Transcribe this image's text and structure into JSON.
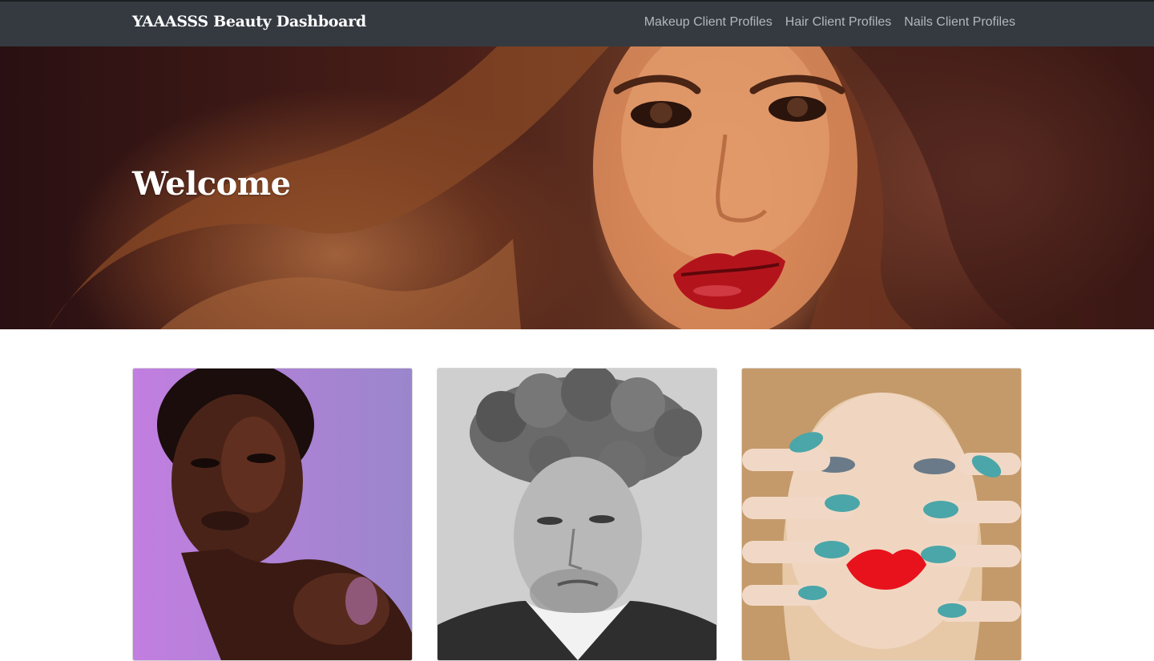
{
  "navbar": {
    "brand": "YAAASSS Beauty Dashboard",
    "links": [
      {
        "label": "Makeup Client Profiles"
      },
      {
        "label": "Hair Client Profiles"
      },
      {
        "label": "Nails Client Profiles"
      }
    ]
  },
  "hero": {
    "title": "Welcome",
    "image": "woman-red-lips-portrait"
  },
  "cards": [
    {
      "image": "makeup-portrait-purple-background"
    },
    {
      "image": "hair-portrait-curly-man-bw"
    },
    {
      "image": "nails-portrait-teal-nails"
    }
  ],
  "colors": {
    "navbar_bg": "#343a40",
    "nav_link": "#b3b8bd",
    "brand": "#ffffff"
  }
}
